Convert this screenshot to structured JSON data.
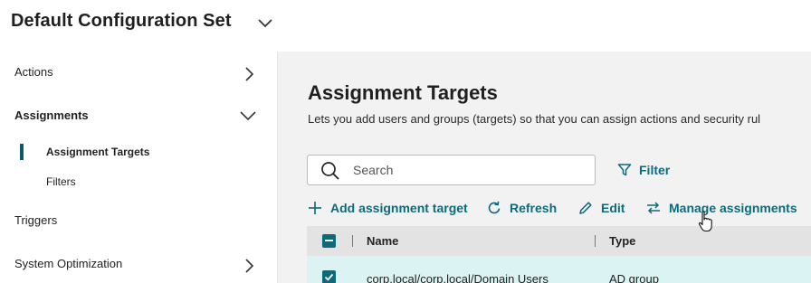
{
  "header": {
    "title": "Default Configuration Set"
  },
  "sidebar": {
    "items": [
      {
        "label": "Actions"
      },
      {
        "label": "Assignments"
      },
      {
        "label": "Triggers"
      },
      {
        "label": "System Optimization"
      }
    ],
    "subitems": [
      {
        "label": "Assignment Targets"
      },
      {
        "label": "Filters"
      }
    ]
  },
  "main": {
    "title": "Assignment Targets",
    "description": "Lets you add users and groups (targets) so that you can assign actions and security rul",
    "search": {
      "placeholder": "Search",
      "value": ""
    },
    "filter_label": "Filter",
    "toolbar": {
      "add": "Add assignment target",
      "refresh": "Refresh",
      "edit": "Edit",
      "manage": "Manage assignments"
    },
    "table": {
      "columns": [
        "Name",
        "Type"
      ],
      "rows": [
        {
          "name": "corp.local/corp.local/Domain Users",
          "type": "AD group"
        }
      ]
    }
  },
  "colors": {
    "accent": "#0d6a7a",
    "active_bar": "#0d5766",
    "selected_row": "#dcf3f3"
  }
}
